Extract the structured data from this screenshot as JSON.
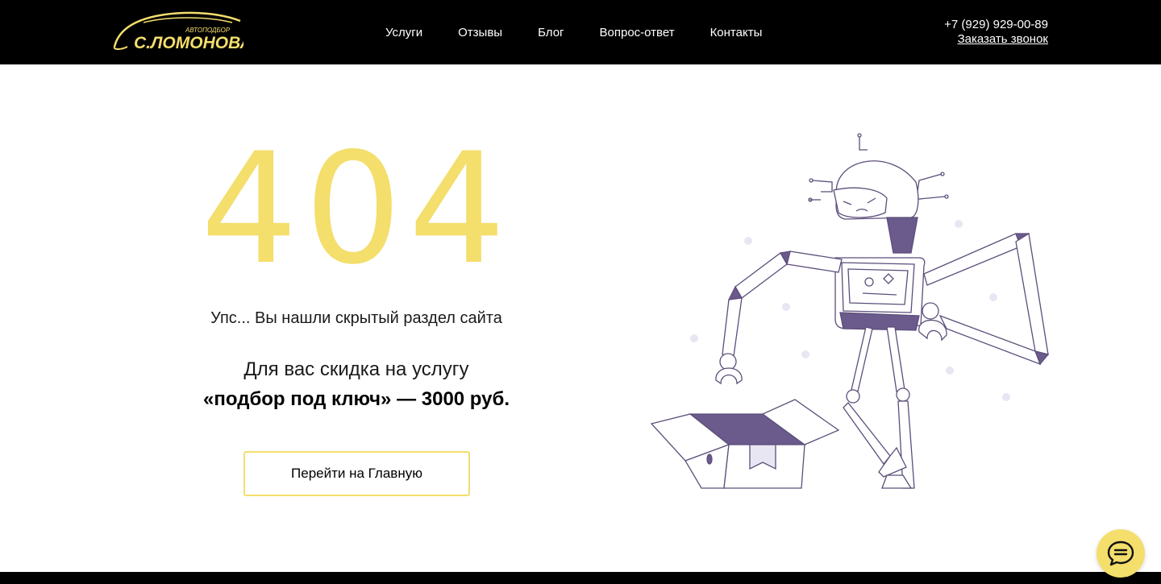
{
  "header": {
    "logo": {
      "brand_small": "АВТОПОДБОР",
      "brand_large": "С.ЛОМОНОВА"
    },
    "nav": [
      "Услуги",
      "Отзывы",
      "Блог",
      "Вопрос-ответ",
      "Контакты"
    ],
    "phone": "+7 (929) 929-00-89",
    "callback_label": "Заказать звонок"
  },
  "error": {
    "code_digits": [
      "4",
      "0",
      "4"
    ],
    "message": "Упс... Вы нашли скрытый раздел сайта",
    "discount_line": "Для вас скидка на услугу",
    "discount_offer": "«подбор под ключ» — 3000 руб.",
    "home_button": "Перейти на Главную"
  },
  "colors": {
    "accent": "#f4de6c",
    "header_bg": "#000000",
    "illustration": "#6b5b8c"
  },
  "icons": {
    "chat": "chat-bubble-icon"
  }
}
